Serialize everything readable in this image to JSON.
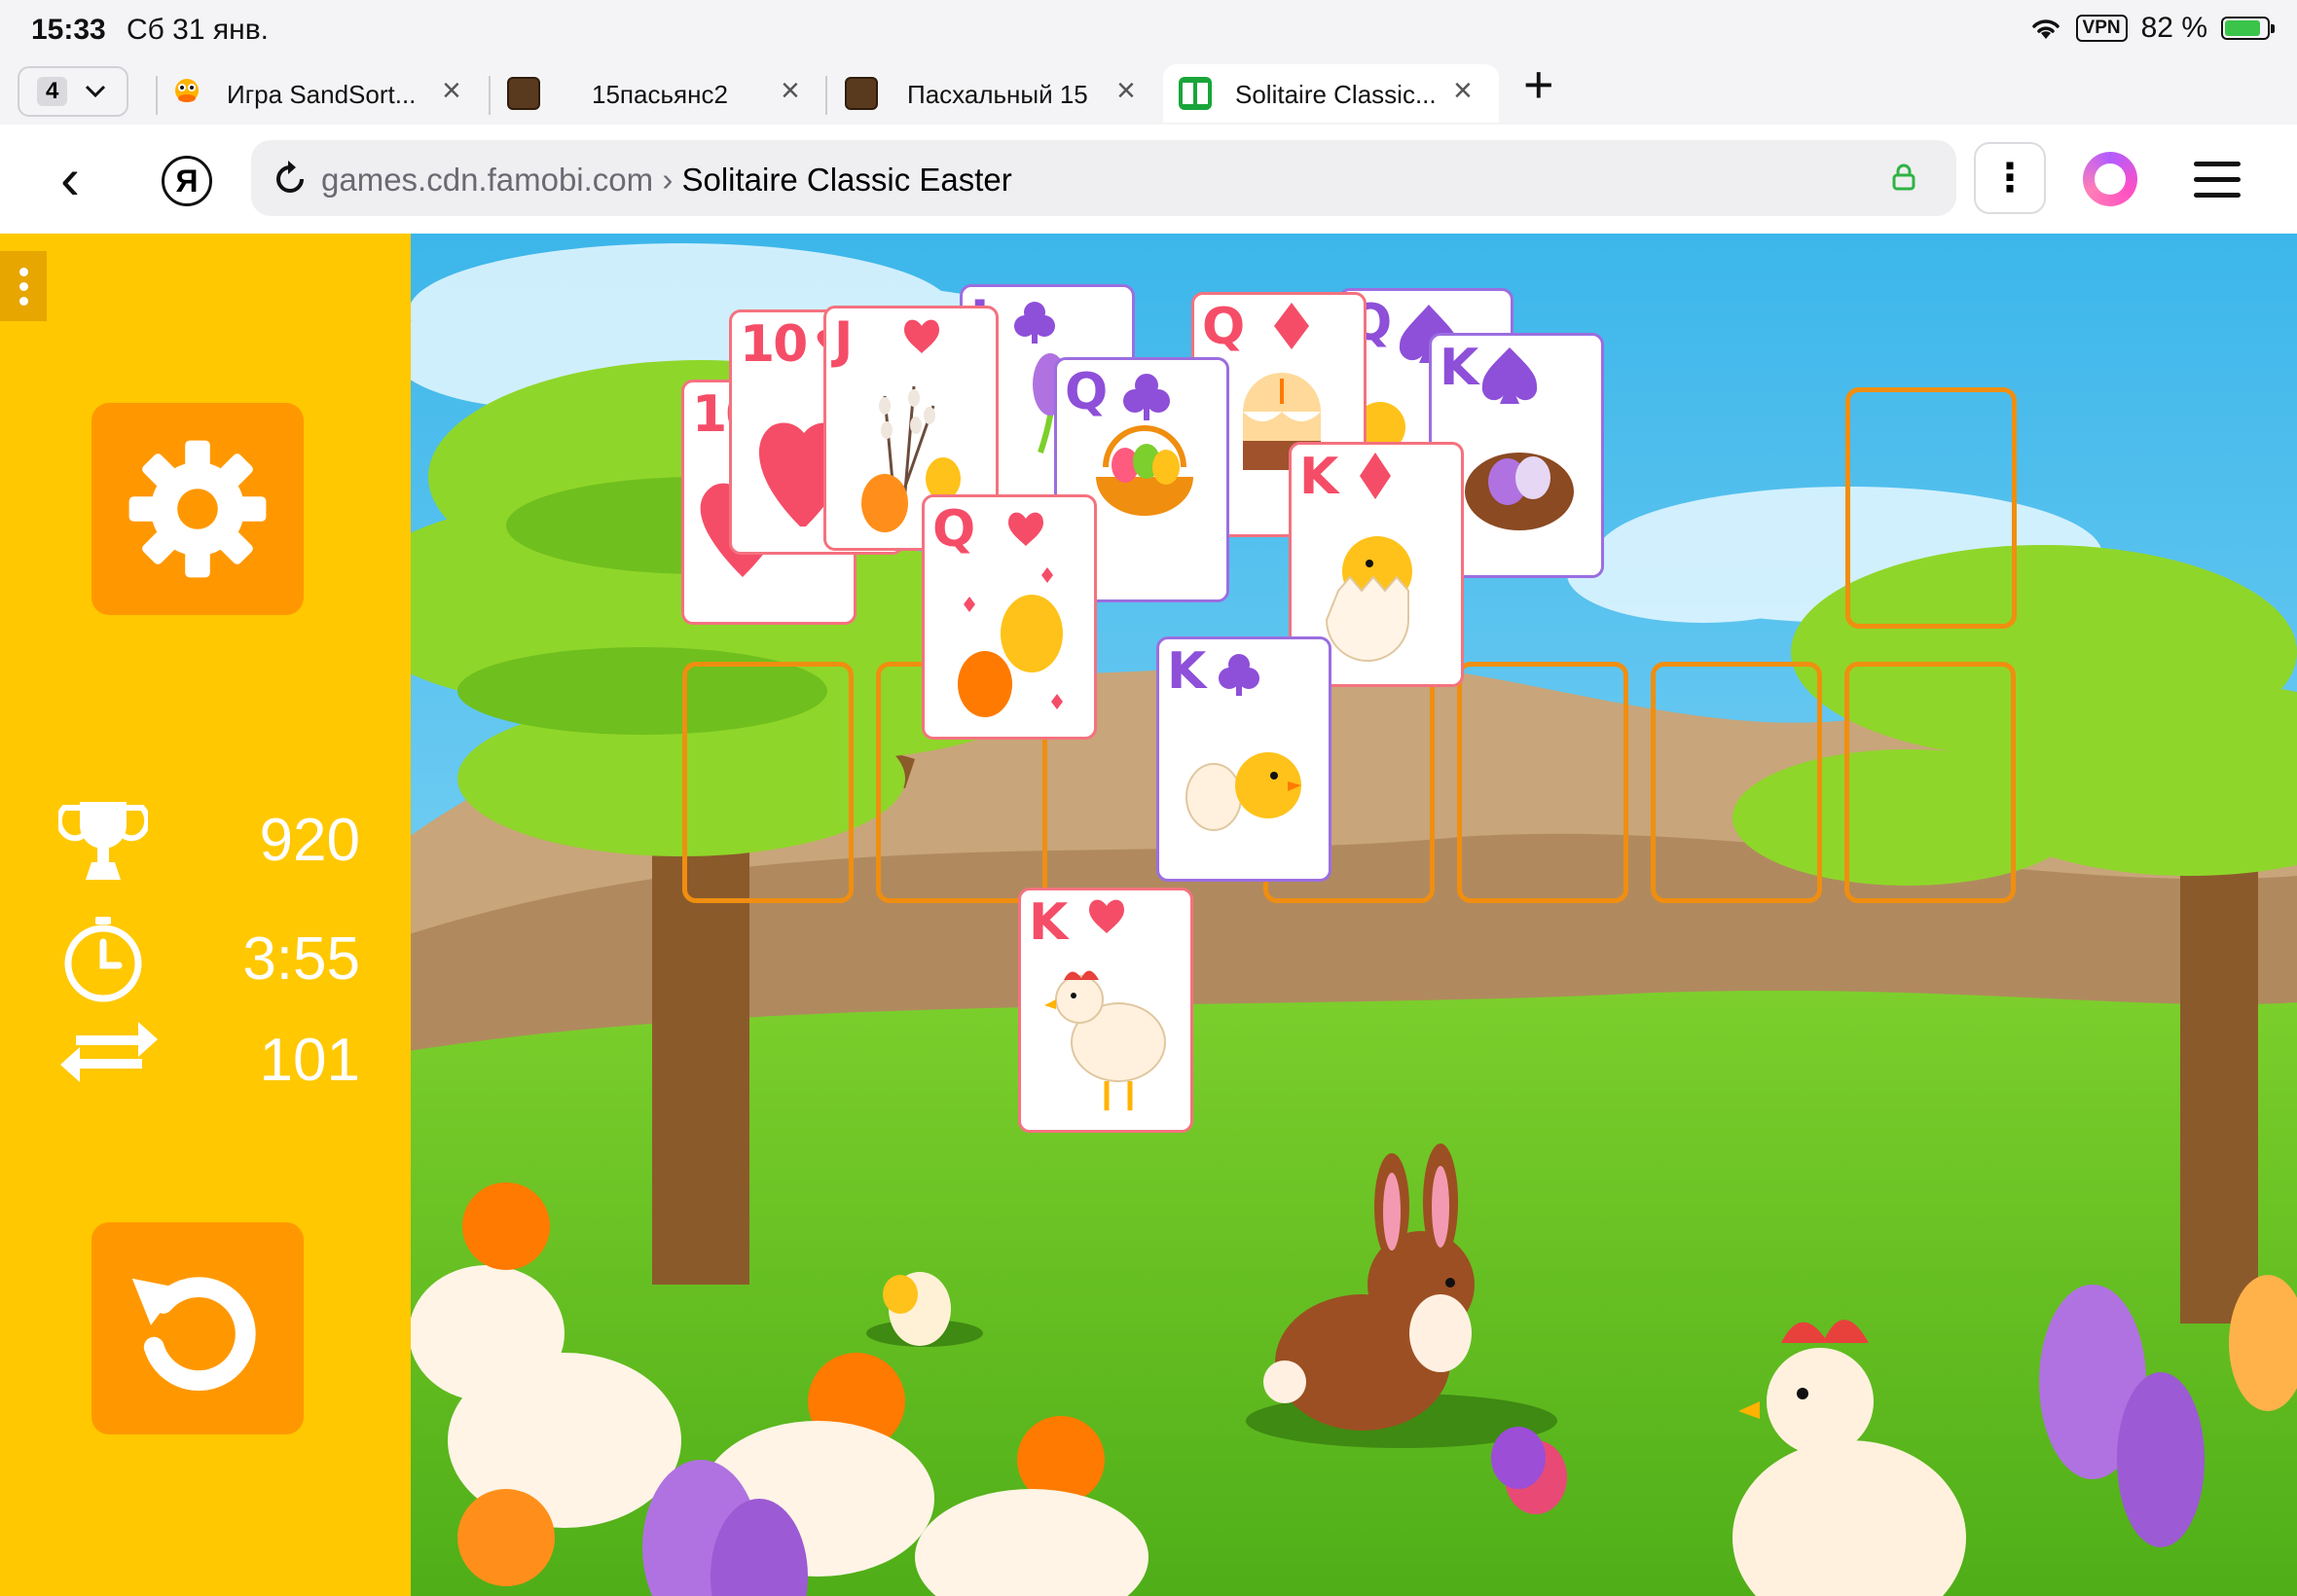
{
  "status_bar": {
    "time": "15:33",
    "date": "Сб 31 янв.",
    "vpn": "VPN",
    "battery": "82 %"
  },
  "tabs": {
    "count": "4",
    "items": [
      {
        "title": "Игра SandSort..."
      },
      {
        "title": "15пасьянс2"
      },
      {
        "title": "Пасхальный 15"
      },
      {
        "title": "Solitaire Classic..."
      }
    ]
  },
  "address": {
    "host": "games.cdn.famobi.com",
    "separator": " › ",
    "page": "Solitaire Classic Easter"
  },
  "game": {
    "title": "Solitaire Classic Easter",
    "stats": {
      "score": "920",
      "time": "3:55",
      "moves": "101"
    },
    "cards": [
      {
        "id": "c10h-back",
        "rank": "10",
        "suit": "heart-suit-icon",
        "color": "red"
      },
      {
        "id": "c10h",
        "rank": "10",
        "suit": "heart-suit-icon",
        "color": "red"
      },
      {
        "id": "cjh",
        "rank": "J",
        "suit": "heart-suit-icon",
        "color": "red"
      },
      {
        "id": "cjc",
        "rank": "J",
        "suit": "club-suit-icon",
        "color": "purple"
      },
      {
        "id": "cqd",
        "rank": "Q",
        "suit": "diamond-suit-icon",
        "color": "red"
      },
      {
        "id": "cqs",
        "rank": "Q",
        "suit": "spade-suit-icon",
        "color": "purple"
      },
      {
        "id": "cqc",
        "rank": "Q",
        "suit": "club-suit-icon",
        "color": "purple"
      },
      {
        "id": "cks",
        "rank": "K",
        "suit": "spade-suit-icon",
        "color": "purple"
      },
      {
        "id": "cqh",
        "rank": "Q",
        "suit": "heart-suit-icon",
        "color": "red"
      },
      {
        "id": "ckd",
        "rank": "K",
        "suit": "diamond-suit-icon",
        "color": "red"
      },
      {
        "id": "ckc",
        "rank": "K",
        "suit": "club-suit-icon",
        "color": "purple"
      },
      {
        "id": "ckh",
        "rank": "K",
        "suit": "heart-suit-icon",
        "color": "red"
      }
    ],
    "colors": {
      "sidebar": "#ffc800",
      "button": "#ff9800",
      "slot_outline": "#f08e10",
      "red_suit": "#f54d68",
      "purple_suit": "#8e4fd9"
    }
  }
}
